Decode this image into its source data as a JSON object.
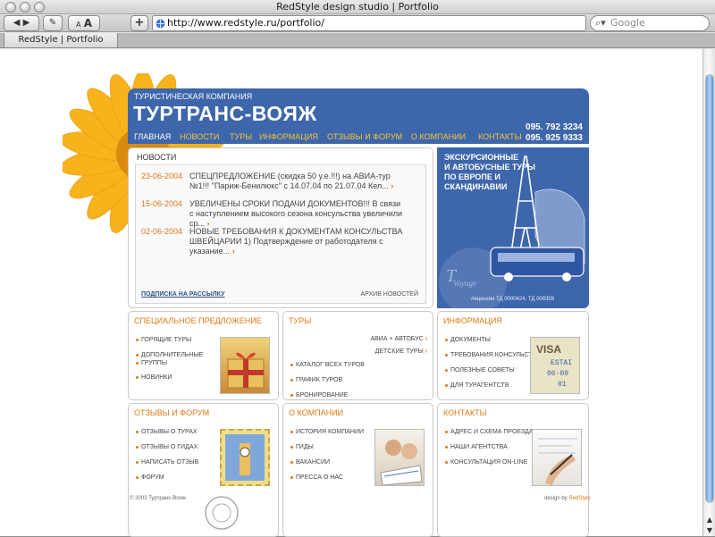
{
  "window": {
    "title": "RedStyle design studio | Portfolio"
  },
  "toolbar": {
    "url": "http://www.redstyle.ru/portfolio/",
    "search_placeholder": "Google",
    "font_small": "A",
    "font_large": "A",
    "add": "+"
  },
  "tab": {
    "label": "RedStyle | Portfolio"
  },
  "site": {
    "subtitle": "ТУРИСТИЧЕСКАЯ КОМПАНИЯ",
    "title": "ТУРТРАНС-ВОЯЖ",
    "phone1": "095. 792 3234",
    "phone2": "095. 925 9333",
    "nav": [
      "ГЛАВНАЯ",
      "НОВОСТИ",
      "ТУРЫ",
      "ИНФОРМАЦИЯ",
      "ОТЗЫВЫ И ФОРУМ",
      "О КОМПАНИИ",
      "КОНТАКТЫ"
    ]
  },
  "news": {
    "heading": "НОВОСТИ",
    "items": [
      {
        "date": "23-06-2004",
        "text": "СПЕЦПРЕДЛОЖЕНИЕ (скидка 50 у.е.!!!) на АВИА-тур №1!!! \"Париж-Бенилюкс\" с 14.07.04 по 21.07.04 Кел..."
      },
      {
        "date": "15-06-2004",
        "text": "УВЕЛИЧЕНЫ СРОКИ ПОДАЧИ ДОКУМЕНТОВ!!! В связи с наступлением высокого сезона консульства увеличили ср..."
      },
      {
        "date": "02-06-2004",
        "text": "НОВЫЕ ТРЕБОВАНИЯ К ДОКУМЕНТАМ КОНСУЛЬСТВА ШВЕЙЦАРИИ 1) Подтверждение от работодателя с указание..."
      }
    ],
    "subscribe": "ПОДПИСКА НА РАССЫЛКУ",
    "archive": "АРХИВ НОВОСТЕЙ"
  },
  "promo": {
    "text1": "ЭКСКУРСИОННЫЕ",
    "text2": "И АВТОБУСНЫЕ ТУРЫ",
    "text3": "ПО ЕВРОПЕ И",
    "text4": "СКАНДИНАВИИ",
    "logo_word": "Voyage",
    "license": "лицензии ТД 0000424, ТД 008359"
  },
  "boxes": {
    "special": {
      "title": "СПЕЦИАЛЬНОЕ ПРЕДЛОЖЕНИЕ",
      "items": [
        "ГОРЯЩИЕ ТУРЫ",
        "ДОПОЛНИТЕЛЬНЫЕ",
        "ГРУППЫ",
        "НОВИНКИ"
      ]
    },
    "tours": {
      "title": "ТУРЫ",
      "links": [
        "АВИА + АВТОБУС",
        "ДЕТСКИЕ ТУРЫ"
      ],
      "items": [
        "КАТАЛОГ ВСЕХ ТУРОВ",
        "ГРАФИК ТУРОВ",
        "БРОНИРОВАНИЕ"
      ]
    },
    "info": {
      "title": "ИНФОРМАЦИЯ",
      "items": [
        "ДОКУМЕНТЫ",
        "ТРЕБОВАНИЯ КОНСУЛЬСТВ",
        "ПОЛЕЗНЫЕ СОВЕТЫ",
        "ДЛЯ ТУРАГЕНТСТВ"
      ],
      "stamp": [
        "VISA",
        "ESTAI",
        "06-09",
        "01"
      ]
    },
    "reviews": {
      "title": "ОТЗЫВЫ И ФОРУМ",
      "items": [
        "ОТЗЫВЫ О ТУРАХ",
        "ОТЗЫВЫ О ГИДАХ",
        "НАПИСАТЬ ОТЗЫВ",
        "ФОРУМ"
      ]
    },
    "about": {
      "title": "О КОМПАНИИ",
      "items": [
        "ИСТОРИЯ КОМПАНИИ",
        "ГИДЫ",
        "ВАКАНСИИ",
        "ПРЕССА О НАС"
      ]
    },
    "contacts": {
      "title": "КОНТАКТЫ",
      "items": [
        "АДРЕС И СХЕМА ПРОЕЗДА",
        "НАШИ АГЕНТСТВА",
        "КОНСУЛЬТАЦИЯ ON-LINE"
      ]
    }
  },
  "footer": {
    "copyright": "© 2003 Туртранс-Вояж",
    "design_by": "design by ",
    "design_brand": "RedStyle"
  },
  "colors": {
    "header_blue": "#3d66ab",
    "accent_orange": "#e07a14",
    "nav_yellow": "#f3c63b"
  }
}
